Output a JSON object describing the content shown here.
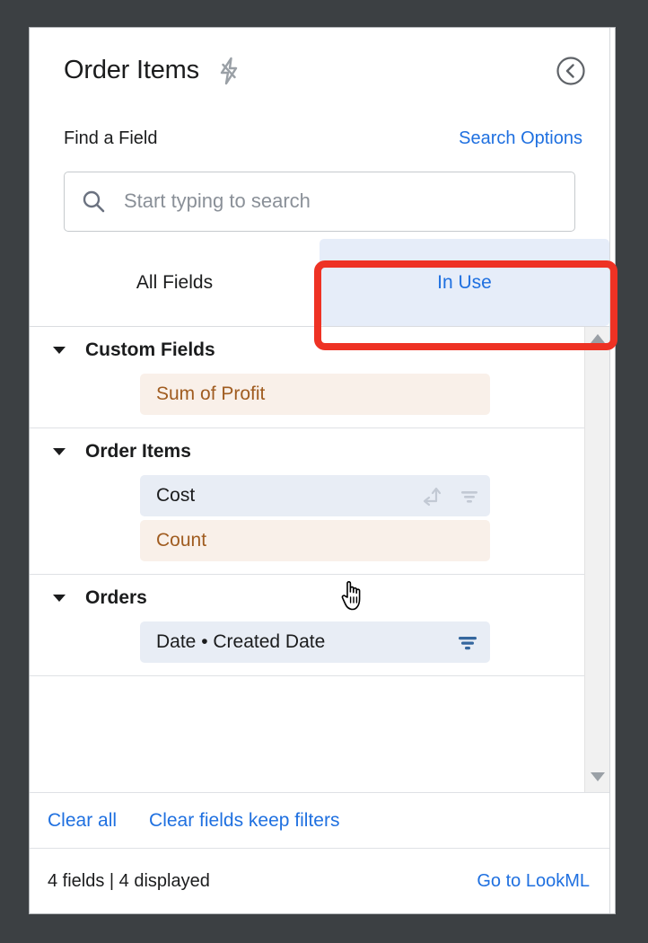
{
  "window": {
    "background_color": "#3c4043",
    "panel_background": "#ffffff"
  },
  "header": {
    "title": "Order Items",
    "bolt_icon": "lightning-bolt-slash-icon",
    "collapse_icon": "circle-chevron-left-icon"
  },
  "find": {
    "label": "Find a Field",
    "search_options_label": "Search Options"
  },
  "search": {
    "icon": "search-icon",
    "value": "",
    "placeholder": "Start typing to search"
  },
  "tabs": [
    {
      "label": "All Fields",
      "active": false
    },
    {
      "label": "In Use",
      "active": true
    }
  ],
  "sections": [
    {
      "title": "Custom Fields",
      "caret": "caret-down-icon",
      "fields": [
        {
          "label": "Sum of Profit",
          "type": "measure",
          "has_pivot": false,
          "has_filter": false,
          "filter_active": false,
          "has_info": false,
          "has_menu": false
        }
      ]
    },
    {
      "title": "Order Items",
      "caret": "caret-down-icon",
      "fields": [
        {
          "label": "Cost",
          "type": "dimension",
          "has_pivot": true,
          "has_filter": true,
          "filter_active": false,
          "has_info": true,
          "has_menu": true
        },
        {
          "label": "Count",
          "type": "measure",
          "has_pivot": false,
          "has_filter": false,
          "filter_active": false,
          "has_info": false,
          "has_menu": false
        }
      ]
    },
    {
      "title": "Orders",
      "caret": "caret-down-icon",
      "fields": [
        {
          "label": "Date • Created Date",
          "type": "dimension",
          "has_pivot": false,
          "has_filter": true,
          "filter_active": true,
          "has_info": false,
          "has_menu": false
        }
      ]
    }
  ],
  "scrollbar": {
    "up_icon": "scroll-up-arrow-icon",
    "down_icon": "scroll-down-arrow-icon"
  },
  "clear_actions": {
    "clear_all_label": "Clear all",
    "clear_fields_keep_filters_label": "Clear fields keep filters"
  },
  "footer": {
    "count_text": "4 fields | 4 displayed",
    "lookml_label": "Go to LookML"
  },
  "annotation": {
    "target": "In Use",
    "color": "#ee3224"
  },
  "cursor": {
    "type": "pointing-hand-cursor"
  },
  "colors": {
    "link_blue": "#1f70e0",
    "tab_active_bg": "#e6edf9",
    "dimension_pill_bg": "#e8edf5",
    "measure_pill_bg": "#f9f0e9",
    "measure_text": "#a05c20",
    "filter_active": "#35679e",
    "annotation_red": "#ee3224"
  }
}
